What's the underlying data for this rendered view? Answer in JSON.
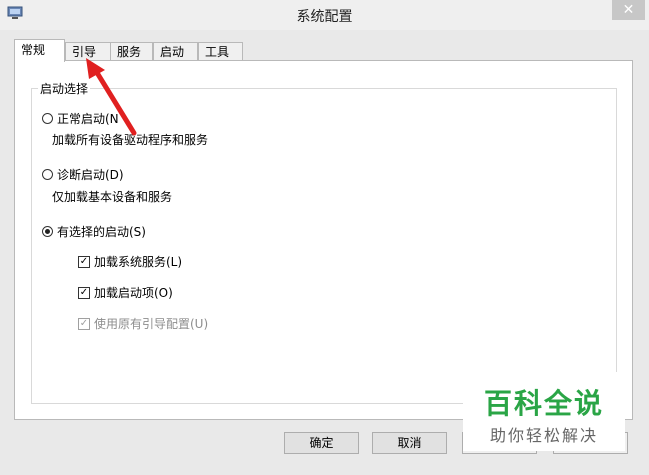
{
  "window": {
    "title": "系统配置",
    "close_glyph": "✕"
  },
  "tabs": [
    {
      "label": "常规",
      "active": true
    },
    {
      "label": "引导",
      "active": false
    },
    {
      "label": "服务",
      "active": false
    },
    {
      "label": "启动",
      "active": false
    },
    {
      "label": "工具",
      "active": false
    }
  ],
  "startup_group": {
    "legend": "启动选择",
    "normal": {
      "label": "正常启动(N",
      "desc": "加载所有设备驱动程序和服务",
      "selected": false
    },
    "diagnostic": {
      "label": "诊断启动(D)",
      "desc": "仅加载基本设备和服务",
      "selected": false
    },
    "selective": {
      "label": "有选择的启动(S)",
      "selected": true,
      "options": [
        {
          "label": "加载系统服务(L)",
          "checked": true,
          "enabled": true
        },
        {
          "label": "加载启动项(O)",
          "checked": true,
          "enabled": true
        },
        {
          "label": "使用原有引导配置(U)",
          "checked": true,
          "enabled": false
        }
      ]
    }
  },
  "buttons": {
    "ok": "确定",
    "cancel": "取消"
  },
  "watermark": {
    "main": "百科全说",
    "sub": "助你轻松解决"
  },
  "colors": {
    "arrow": "#e02020",
    "watermark_green": "#2aa546"
  }
}
